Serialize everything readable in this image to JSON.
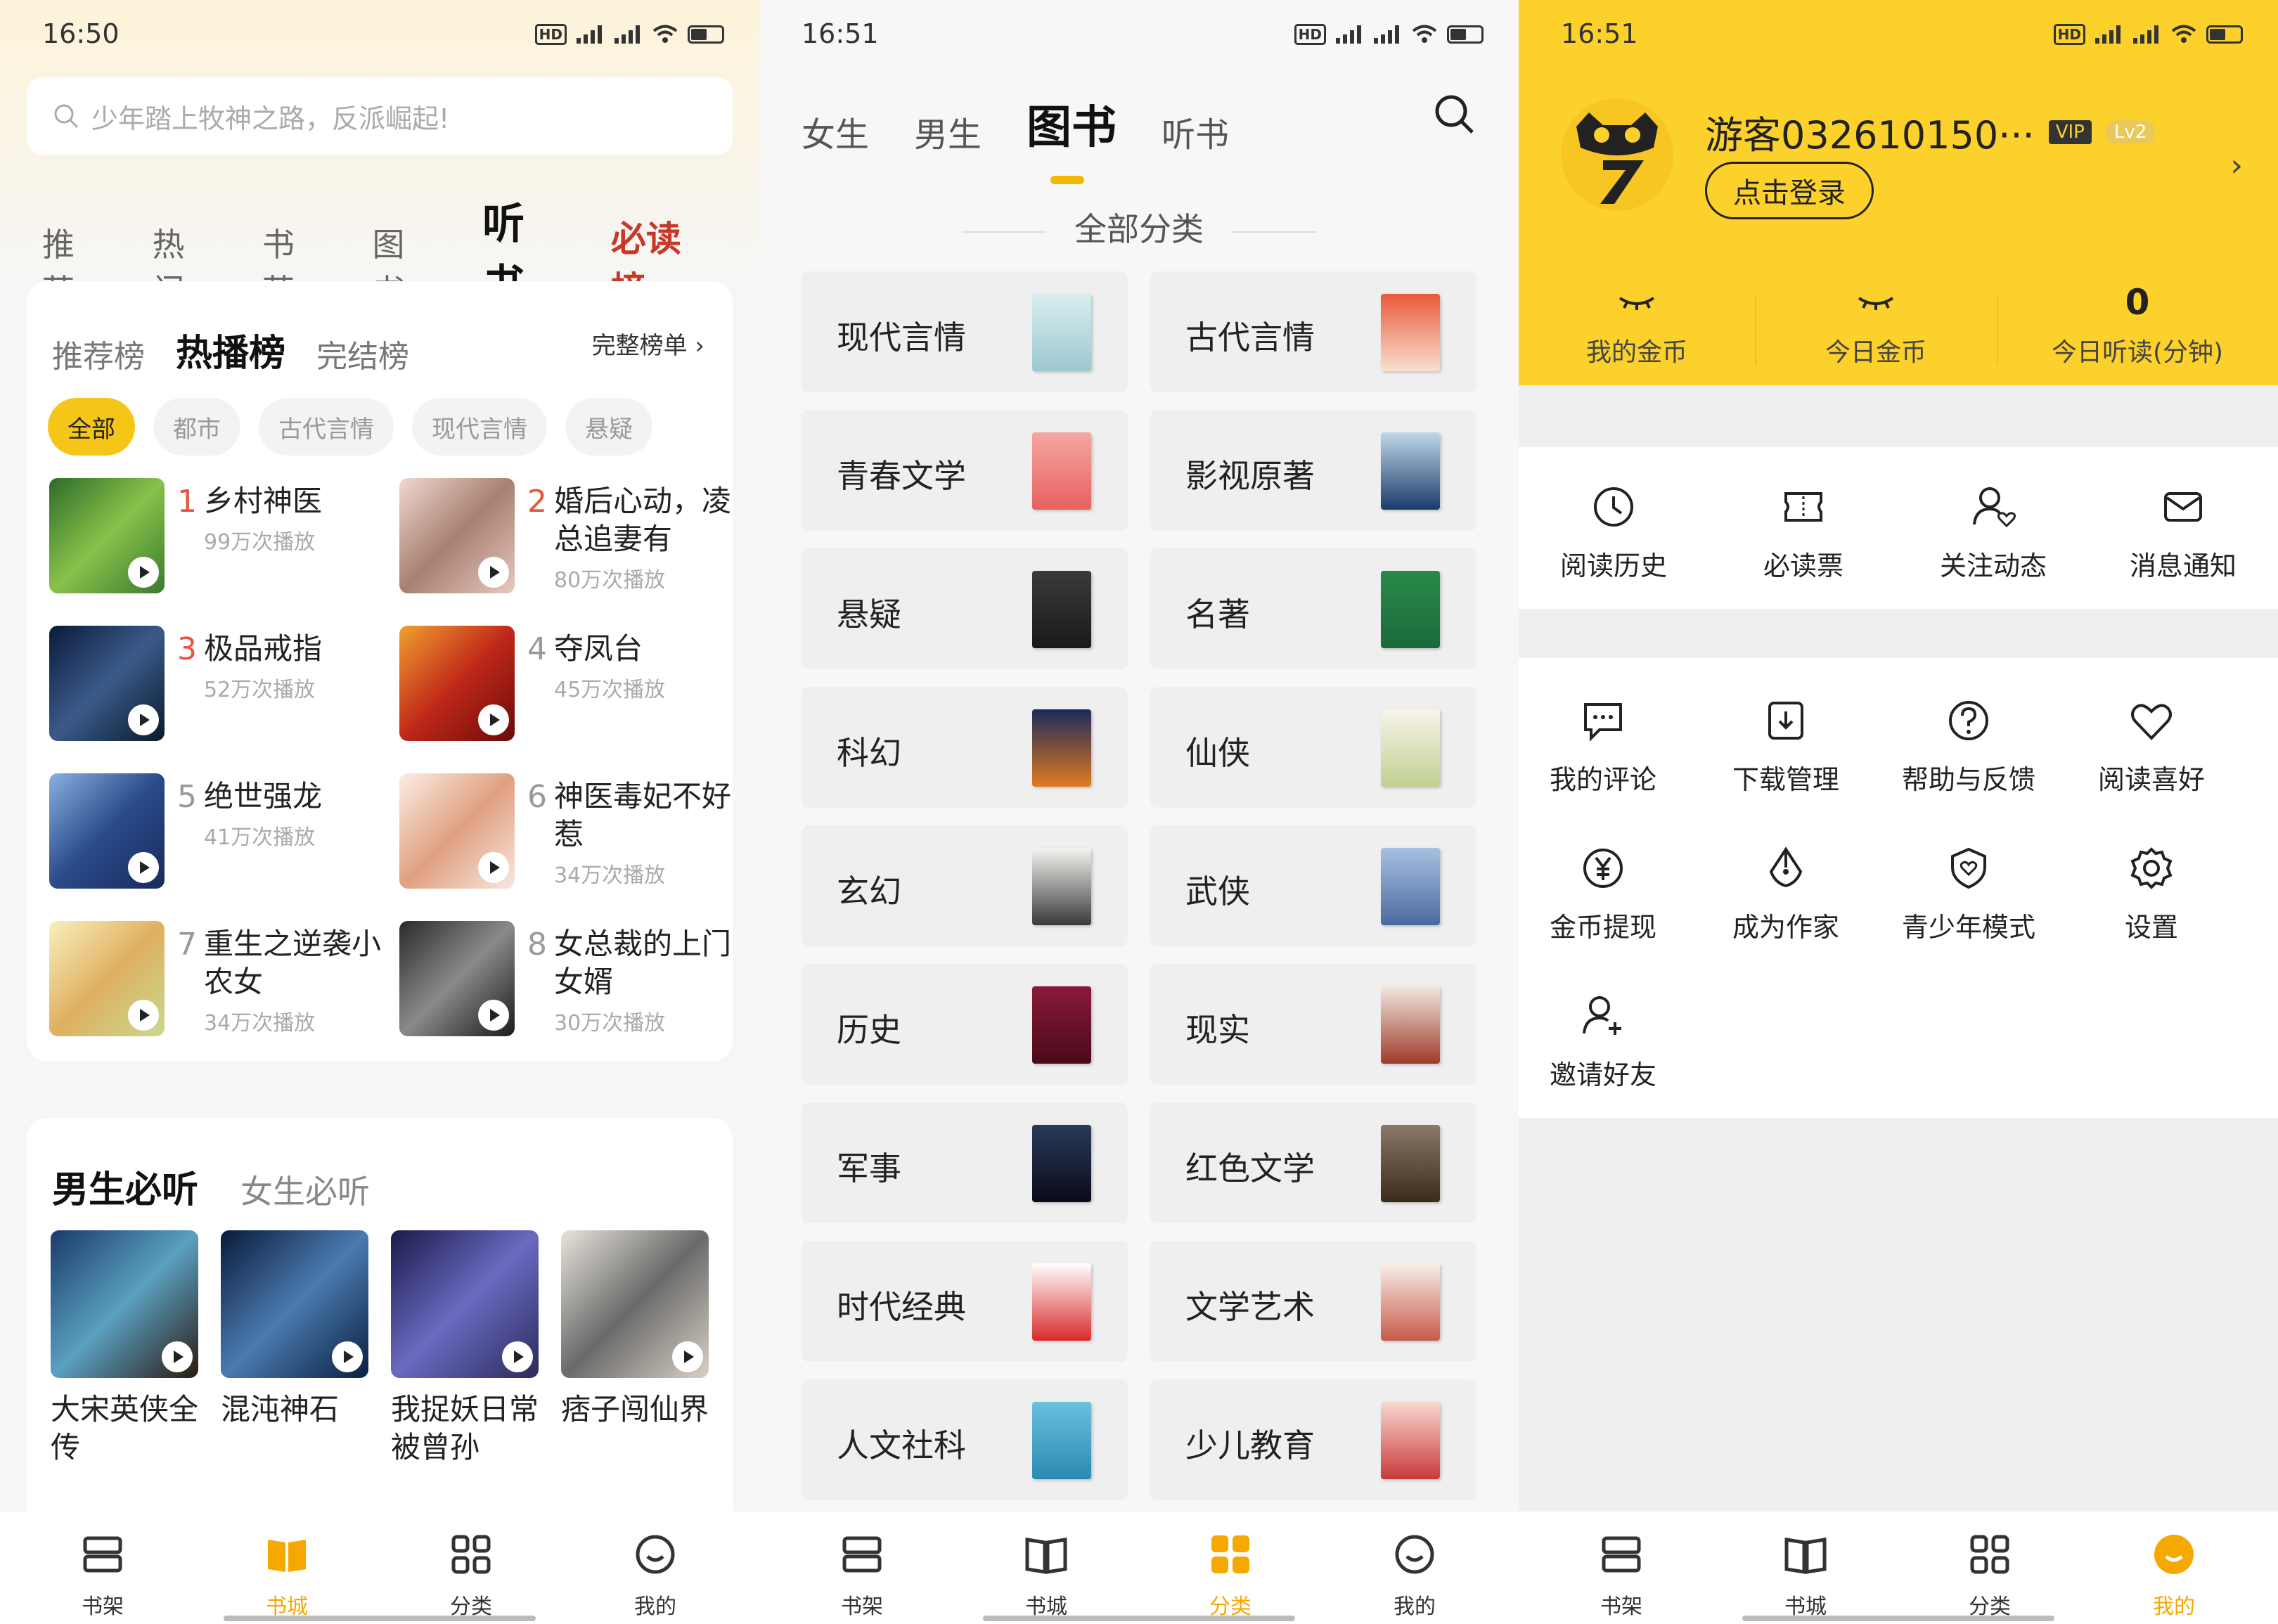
{
  "status": {
    "time1": "16:50",
    "time2": "16:51",
    "time3": "16:51",
    "hd": "HD",
    "net": "5G"
  },
  "p1": {
    "search_placeholder": "少年踏上牧神之路，反派崛起!",
    "nav": [
      "推荐",
      "热门",
      "书荒",
      "图书",
      "听书",
      "必读榜"
    ],
    "rank_tabs": [
      "推荐榜",
      "热播榜",
      "完结榜"
    ],
    "full_rank": "完整榜单 ›",
    "chips": [
      "全部",
      "都市",
      "古代言情",
      "现代言情",
      "悬疑"
    ],
    "rank": [
      {
        "num": "1",
        "title": "乡村神医",
        "plays": "99万次播放"
      },
      {
        "num": "2",
        "title": "婚后心动，凌总追妻有",
        "plays": "80万次播放"
      },
      {
        "num": "3",
        "title": "极品戒指",
        "plays": "52万次播放"
      },
      {
        "num": "4",
        "title": "夺凤台",
        "plays": "45万次播放"
      },
      {
        "num": "5",
        "title": "绝世强龙",
        "plays": "41万次播放"
      },
      {
        "num": "6",
        "title": "神医毒妃不好惹",
        "plays": "34万次播放"
      },
      {
        "num": "7",
        "title": "重生之逆袭小农女",
        "plays": "34万次播放"
      },
      {
        "num": "8",
        "title": "女总裁的上门女婿",
        "plays": "30万次播放"
      }
    ],
    "must_tabs": [
      "男生必听",
      "女生必听"
    ],
    "must": [
      {
        "title": "大宋英侠全传"
      },
      {
        "title": "混沌神石"
      },
      {
        "title": "我捉妖日常被曾孙"
      },
      {
        "title": "痞子闯仙界"
      }
    ]
  },
  "tabbar": {
    "shelf": "书架",
    "store": "书城",
    "category": "分类",
    "mine": "我的"
  },
  "p2": {
    "nav": [
      "女生",
      "男生",
      "图书",
      "听书"
    ],
    "all_category": "全部分类",
    "categories": [
      "现代言情",
      "古代言情",
      "青春文学",
      "影视原著",
      "悬疑",
      "名著",
      "科幻",
      "仙侠",
      "玄幻",
      "武侠",
      "历史",
      "现实",
      "军事",
      "红色文学",
      "时代经典",
      "文学艺术",
      "人文社科",
      "少儿教育"
    ]
  },
  "p3": {
    "username": "游客032610150···",
    "vip": "VIP",
    "level": "Lv2",
    "login": "点击登录",
    "stats": [
      {
        "value": "",
        "label": "我的金币"
      },
      {
        "value": "",
        "label": "今日金币"
      },
      {
        "value": "0",
        "label": "今日听读(分钟)"
      }
    ],
    "row1": [
      "阅读历史",
      "必读票",
      "关注动态",
      "消息通知"
    ],
    "grid": [
      "我的评论",
      "下载管理",
      "帮助与反馈",
      "阅读喜好",
      "金币提现",
      "成为作家",
      "青少年模式",
      "设置",
      "邀请好友"
    ]
  },
  "colors": {
    "accent": "#f5b800",
    "header_yellow": "#fcd12c",
    "rank_red": "#e8553c"
  }
}
